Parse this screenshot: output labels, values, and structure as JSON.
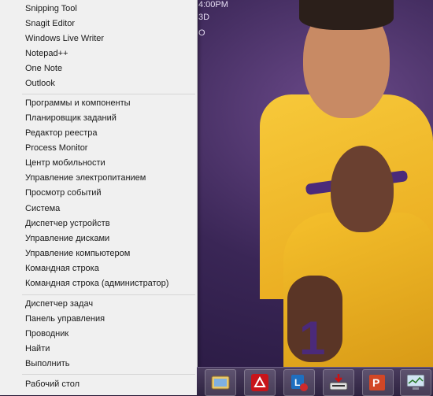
{
  "desktop": {
    "clock_fragment": "4:00PM",
    "text_fragment_2": "3D",
    "text_fragment_3": "O"
  },
  "menu": {
    "group1": [
      "Snipping Tool",
      "Snagit Editor",
      "Windows Live Writer",
      "Notepad++",
      "One Note",
      "Outlook"
    ],
    "group2": [
      "Программы и компоненты",
      "Планировщик заданий",
      "Редактор реестра",
      "Process Monitor",
      "Центр мобильности",
      "Управление электропитанием",
      "Просмотр событий",
      "Система",
      "Диспетчер устройств",
      "Управление дисками",
      "Управление компьютером",
      "Командная строка",
      "Командная строка (администратор)"
    ],
    "group3": [
      "Диспетчер задач",
      "Панель управления",
      "Проводник",
      "Найти",
      "Выполнить"
    ],
    "group4": [
      "Рабочий стол"
    ]
  },
  "taskbar": {
    "apps": [
      "image-viewer-icon",
      "acrobat-icon",
      "lync-icon",
      "scanner-icon",
      "powerpoint-icon",
      "monitor-icon"
    ]
  },
  "wallpaper": {
    "jersey_number": "1"
  }
}
